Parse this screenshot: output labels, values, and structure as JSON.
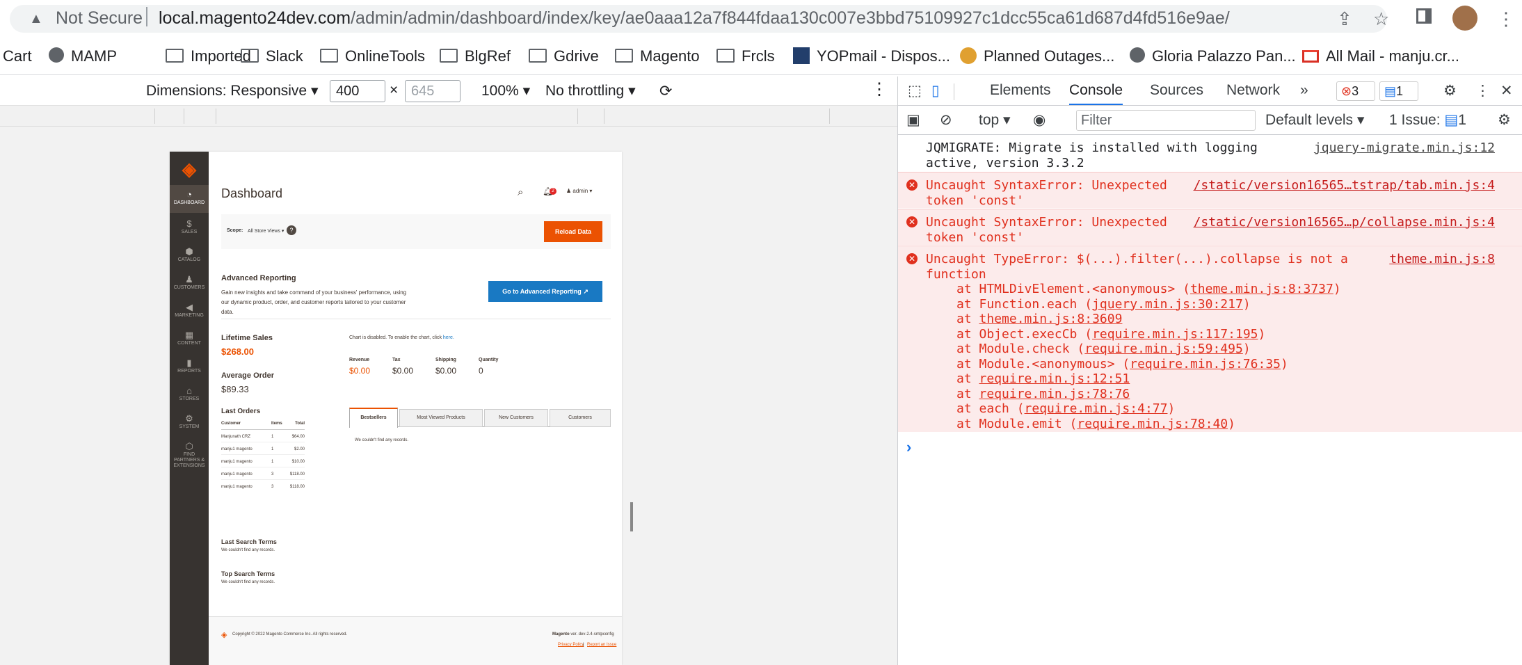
{
  "browser": {
    "security_label": "Not Secure",
    "url_host": "local.magento24dev.com",
    "url_path": "/admin/admin/dashboard/index/key/ae0aaa12a7f844fdaa130c007e3bbd75109927c1dcc55ca61d687d4fd516e9ae/"
  },
  "bookmarks": [
    {
      "label": "Cart"
    },
    {
      "label": "MAMP"
    },
    {
      "label": "Imported"
    },
    {
      "label": "Slack"
    },
    {
      "label": "OnlineTools"
    },
    {
      "label": "BlgRef"
    },
    {
      "label": "Gdrive"
    },
    {
      "label": "Magento"
    },
    {
      "label": "Frcls"
    },
    {
      "label": "YOPmail - Dispos..."
    },
    {
      "label": "Planned Outages..."
    },
    {
      "label": "Gloria Palazzo Pan..."
    },
    {
      "label": "All Mail - manju.cr..."
    }
  ],
  "device_toolbar": {
    "dimensions": "Dimensions: Responsive",
    "width": "400",
    "height": "645",
    "zoom": "100%",
    "throttling": "No throttling"
  },
  "magento": {
    "nav": [
      {
        "label": "DASHBOARD",
        "icon": "dashboard-icon"
      },
      {
        "label": "SALES",
        "icon": "dollar-icon"
      },
      {
        "label": "CATALOG",
        "icon": "cube-icon"
      },
      {
        "label": "CUSTOMERS",
        "icon": "person-icon"
      },
      {
        "label": "MARKETING",
        "icon": "megaphone-icon"
      },
      {
        "label": "CONTENT",
        "icon": "layout-icon"
      },
      {
        "label": "REPORTS",
        "icon": "bar-chart-icon"
      },
      {
        "label": "STORES",
        "icon": "store-icon"
      },
      {
        "label": "SYSTEM",
        "icon": "gear-icon"
      },
      {
        "label": "FIND PARTNERS & EXTENSIONS",
        "icon": "box-icon"
      }
    ],
    "page_title": "Dashboard",
    "notif_count": "2",
    "user": "admin",
    "scope_label": "Scope:",
    "scope_value": "All Store Views",
    "reload_button": "Reload Data",
    "adv_title": "Advanced Reporting",
    "adv_text": "Gain new insights and take command of your business' performance, using our dynamic product, order, and customer reports tailored to your customer data.",
    "adv_button": "Go to Advanced Reporting",
    "lifetime_label": "Lifetime Sales",
    "lifetime_value": "$268.00",
    "avg_label": "Average Order",
    "avg_value": "$89.33",
    "chart_disabled": "Chart is disabled. To enable the chart, click",
    "chart_here": "here.",
    "stats": [
      {
        "label": "Revenue",
        "value": "$0.00"
      },
      {
        "label": "Tax",
        "value": "$0.00"
      },
      {
        "label": "Shipping",
        "value": "$0.00"
      },
      {
        "label": "Quantity",
        "value": "0"
      }
    ],
    "last_orders_title": "Last Orders",
    "orders_headers": [
      "Customer",
      "Items",
      "Total"
    ],
    "orders": [
      [
        "Manjunath CRZ",
        "1",
        "$64.00"
      ],
      [
        "manju1 magento",
        "1",
        "$2.00"
      ],
      [
        "manju1 magento",
        "1",
        "$10.00"
      ],
      [
        "manju1 magento",
        "3",
        "$118.00"
      ],
      [
        "manju1 magento",
        "3",
        "$118.00"
      ]
    ],
    "tabs": [
      "Bestsellers",
      "Most Viewed Products",
      "New Customers",
      "Customers"
    ],
    "no_records": "We couldn't find any records.",
    "last_search_title": "Last Search Terms",
    "last_search_text": "We couldn't find any records.",
    "top_search_title": "Top Search Terms",
    "top_search_text": "We couldn't find any records.",
    "copyright": "Copyright © 2022 Magento Commerce Inc. All rights reserved.",
    "version_brand": "Magento",
    "version_text": "ver. dev-2.4-smtpconfig",
    "privacy": "Privacy Policy",
    "report": "Report an Issue"
  },
  "devtools": {
    "tabs": [
      "Elements",
      "Console",
      "Sources",
      "Network"
    ],
    "error_count": "3",
    "msg_count": "1",
    "context": "top",
    "filter_placeholder": "Filter",
    "levels": "Default levels",
    "issues_label": "1 Issue:",
    "issues_count": "1",
    "messages": [
      {
        "type": "log",
        "text": "JQMIGRATE: Migrate is installed with logging\nactive, version 3.3.2",
        "src": "jquery-migrate.min.js:12"
      },
      {
        "type": "error",
        "text": "Uncaught SyntaxError: Unexpected\ntoken 'const'",
        "src": "/static/version16565…tstrap/tab.min.js:4"
      },
      {
        "type": "error",
        "text": "Uncaught SyntaxError: Unexpected\ntoken 'const'",
        "src": "/static/version16565…p/collapse.min.js:4"
      },
      {
        "type": "error",
        "text": "Uncaught TypeError: $(...).filter(...).collapse is not a\nfunction",
        "src": "theme.min.js:8"
      }
    ],
    "stack": [
      {
        "pre": "at HTMLDivElement.<anonymous> (",
        "link": "theme.min.js:8:3737",
        "post": ")"
      },
      {
        "pre": "at Function.each (",
        "link": "jquery.min.js:30:217",
        "post": ")"
      },
      {
        "pre": "at ",
        "link": "theme.min.js:8:3609",
        "post": ""
      },
      {
        "pre": "at Object.execCb (",
        "link": "require.min.js:117:195",
        "post": ")"
      },
      {
        "pre": "at Module.check (",
        "link": "require.min.js:59:495",
        "post": ")"
      },
      {
        "pre": "at Module.<anonymous> (",
        "link": "require.min.js:76:35",
        "post": ")"
      },
      {
        "pre": "at ",
        "link": "require.min.js:12:51",
        "post": ""
      },
      {
        "pre": "at ",
        "link": "require.min.js:78:76",
        "post": ""
      },
      {
        "pre": "at each (",
        "link": "require.min.js:4:77",
        "post": ")"
      },
      {
        "pre": "at Module.emit (",
        "link": "require.min.js:78:40",
        "post": ")"
      }
    ],
    "prompt": "›"
  }
}
